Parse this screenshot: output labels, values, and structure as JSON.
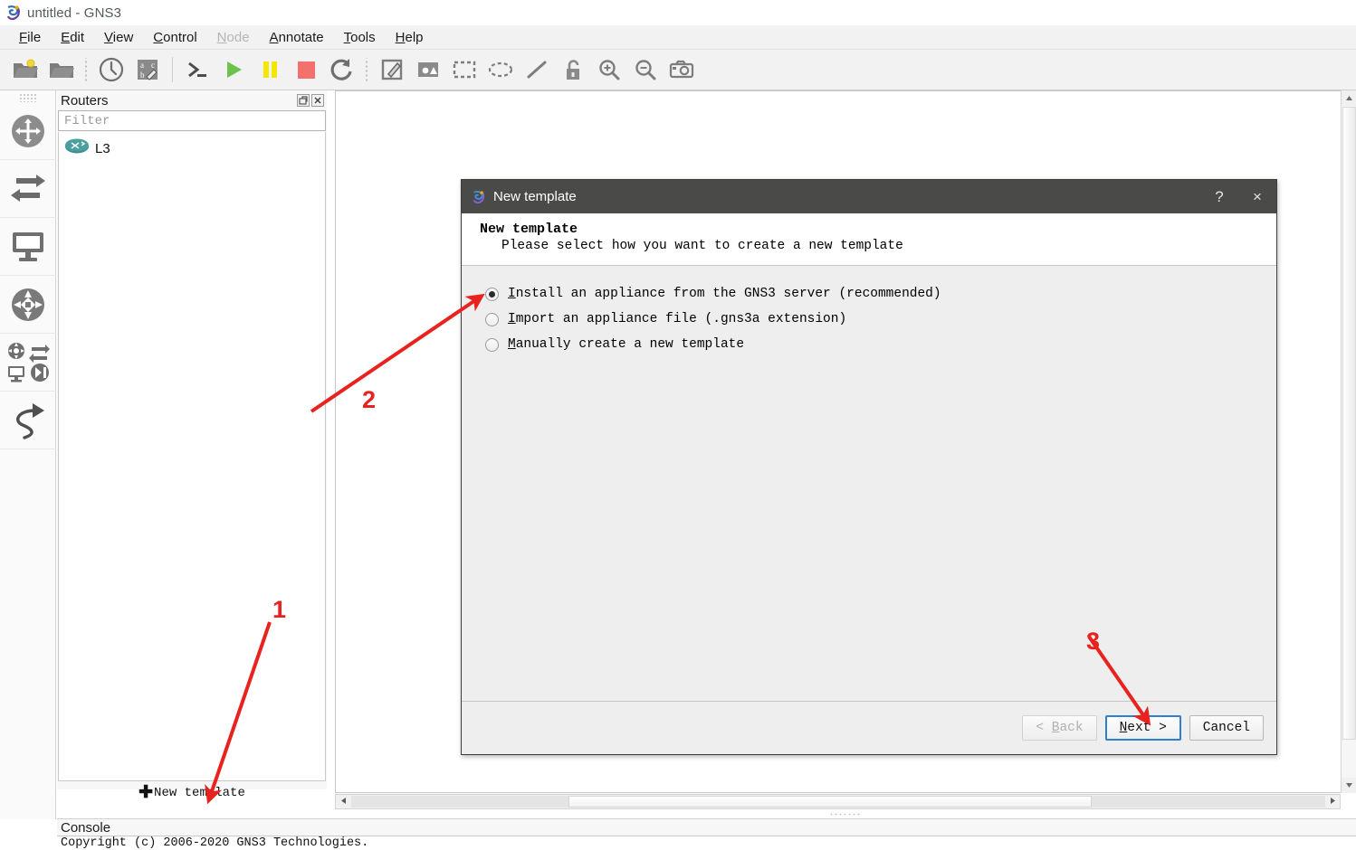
{
  "window": {
    "title": "untitled - GNS3",
    "app_icon": "gns3-logo-icon"
  },
  "menubar": {
    "items": [
      {
        "label": "File",
        "mnemonic": "F",
        "disabled": false
      },
      {
        "label": "Edit",
        "mnemonic": "E",
        "disabled": false
      },
      {
        "label": "View",
        "mnemonic": "V",
        "disabled": false
      },
      {
        "label": "Control",
        "mnemonic": "C",
        "disabled": false
      },
      {
        "label": "Node",
        "mnemonic": "N",
        "disabled": true
      },
      {
        "label": "Annotate",
        "mnemonic": "A",
        "disabled": false
      },
      {
        "label": "Tools",
        "mnemonic": "T",
        "disabled": false
      },
      {
        "label": "Help",
        "mnemonic": "H",
        "disabled": false
      }
    ]
  },
  "toolbar": {
    "buttons": [
      {
        "icon": "new-project-icon"
      },
      {
        "icon": "open-project-icon"
      },
      {
        "icon": "separator-dots"
      },
      {
        "icon": "recent-projects-clock-icon"
      },
      {
        "icon": "screenshot-abc-icon"
      },
      {
        "icon": "separator-line"
      },
      {
        "icon": "console-prompt-icon"
      },
      {
        "icon": "start-play-icon"
      },
      {
        "icon": "pause-icon"
      },
      {
        "icon": "stop-icon"
      },
      {
        "icon": "reload-icon"
      },
      {
        "icon": "separator-dots"
      },
      {
        "icon": "add-note-icon"
      },
      {
        "icon": "insert-image-icon"
      },
      {
        "icon": "draw-rectangle-icon"
      },
      {
        "icon": "draw-ellipse-icon"
      },
      {
        "icon": "draw-line-icon"
      },
      {
        "icon": "lock-icon"
      },
      {
        "icon": "zoom-in-icon"
      },
      {
        "icon": "zoom-out-icon"
      },
      {
        "icon": "camera-screenshot-icon"
      }
    ]
  },
  "device_bar": {
    "items": [
      {
        "icon": "routers-icon",
        "tooltip": "Routers"
      },
      {
        "icon": "switches-icon",
        "tooltip": "Switches"
      },
      {
        "icon": "end-devices-icon",
        "tooltip": "End devices"
      },
      {
        "icon": "security-devices-icon",
        "tooltip": "Security devices"
      },
      {
        "icon": "all-devices-icon",
        "tooltip": "All devices"
      },
      {
        "icon": "add-link-icon",
        "tooltip": "Add a link"
      }
    ]
  },
  "dock": {
    "title": "Routers",
    "float_button": "undock-icon",
    "close_button": "close-icon",
    "filter": {
      "value": "",
      "placeholder": "Filter"
    },
    "items": [
      {
        "label": "L3",
        "icon": "router-icon"
      }
    ],
    "footer": {
      "label": "New template",
      "icon": "plus-icon"
    }
  },
  "console": {
    "title": "Console",
    "lines": [
      "Copyright (c) 2006-2020 GNS3 Technologies."
    ]
  },
  "dialog": {
    "titlebar": {
      "title": "New template",
      "icon": "gns3-logo-icon",
      "help_button": "?",
      "close_button": "×"
    },
    "heading": "New template",
    "subheading": "Please select how you want to create a new template",
    "options": [
      {
        "label_pre": "",
        "mnemonic": "I",
        "label_post": "nstall an appliance from the GNS3 server (recommended)",
        "selected": true
      },
      {
        "label_pre": "",
        "mnemonic": "I",
        "label_post": "mport an appliance file (.gns3a extension)",
        "selected": false
      },
      {
        "label_pre": "",
        "mnemonic": "M",
        "label_post": "anually create a new template",
        "selected": false
      }
    ],
    "buttons": [
      {
        "name": "back",
        "text_pre": "< ",
        "mnemonic": "B",
        "text_post": "ack",
        "state": "disabled"
      },
      {
        "name": "next",
        "text_pre": "",
        "mnemonic": "N",
        "text_post": "ext >",
        "state": "default"
      },
      {
        "name": "cancel",
        "text_pre": "Cancel",
        "mnemonic": "",
        "text_post": "",
        "state": "normal"
      }
    ]
  },
  "annotations": {
    "color": "#e8231f",
    "markers": [
      {
        "label": "1",
        "target": "new-template-footer-button"
      },
      {
        "label": "2",
        "target": "install-appliance-radio"
      },
      {
        "label": "3",
        "target": "next-button"
      }
    ]
  },
  "scrollbars": {
    "vertical": {
      "up_arrow": "▲",
      "down_arrow": "▼"
    },
    "horizontal": {
      "left_arrow": "◀",
      "right_arrow": "▶"
    }
  }
}
